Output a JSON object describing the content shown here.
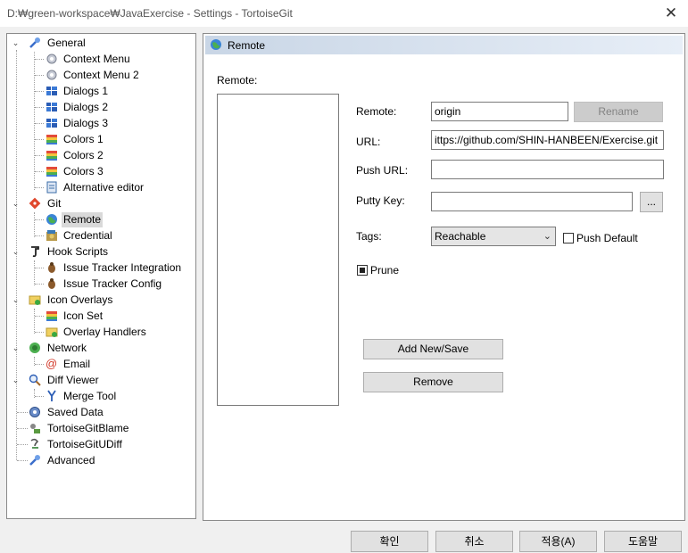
{
  "window": {
    "title": "D:₩green-workspace₩JavaExercise - Settings - TortoiseGit",
    "close_glyph": "✕"
  },
  "tree": {
    "items": [
      {
        "label": "General",
        "icon": "wrench-icon"
      },
      {
        "label": "Context Menu",
        "icon": "gear-icon"
      },
      {
        "label": "Context Menu 2",
        "icon": "gear-icon"
      },
      {
        "label": "Dialogs 1",
        "icon": "windows-icon"
      },
      {
        "label": "Dialogs 2",
        "icon": "windows-icon"
      },
      {
        "label": "Dialogs 3",
        "icon": "windows-icon"
      },
      {
        "label": "Colors 1",
        "icon": "palette-icon"
      },
      {
        "label": "Colors 2",
        "icon": "palette-icon"
      },
      {
        "label": "Colors 3",
        "icon": "palette-icon"
      },
      {
        "label": "Alternative editor",
        "icon": "notepad-icon"
      },
      {
        "label": "Git",
        "icon": "git-icon"
      },
      {
        "label": "Remote",
        "icon": "globe-icon"
      },
      {
        "label": "Credential",
        "icon": "credential-icon"
      },
      {
        "label": "Hook Scripts",
        "icon": "hook-icon"
      },
      {
        "label": "Issue Tracker Integration",
        "icon": "bug-icon"
      },
      {
        "label": "Issue Tracker Config",
        "icon": "bug-icon"
      },
      {
        "label": "Icon Overlays",
        "icon": "overlay-icon"
      },
      {
        "label": "Icon Set",
        "icon": "palette-icon"
      },
      {
        "label": "Overlay Handlers",
        "icon": "overlay-icon"
      },
      {
        "label": "Network",
        "icon": "network-icon"
      },
      {
        "label": "Email",
        "icon": "email-icon"
      },
      {
        "label": "Diff Viewer",
        "icon": "magnifier-icon"
      },
      {
        "label": "Merge Tool",
        "icon": "merge-icon"
      },
      {
        "label": "Saved Data",
        "icon": "saved-data-icon"
      },
      {
        "label": "TortoiseGitBlame",
        "icon": "blame-icon"
      },
      {
        "label": "TortoiseGitUDiff",
        "icon": "udiff-icon"
      },
      {
        "label": "Advanced",
        "icon": "wrench-icon"
      }
    ],
    "selected": "Remote"
  },
  "page": {
    "header": "Remote",
    "remote_list_label": "Remote:",
    "remote_label": "Remote:",
    "remote_value": "origin",
    "rename_label": "Rename",
    "url_label": "URL:",
    "url_value": "ittps://github.com/SHIN-HANBEEN/Exercise.git",
    "push_url_label": "Push URL:",
    "push_url_value": "",
    "putty_key_label": "Putty Key:",
    "putty_key_value": "",
    "browse_label": "...",
    "tags_label": "Tags:",
    "tags_value": "Reachable",
    "push_default_label": "Push Default",
    "push_default_checked": false,
    "prune_label": "Prune",
    "prune_checked": true,
    "add_save_label": "Add New/Save",
    "remove_label": "Remove"
  },
  "buttons": {
    "ok": "확인",
    "cancel": "취소",
    "apply": "적용(A)",
    "help": "도움말"
  }
}
